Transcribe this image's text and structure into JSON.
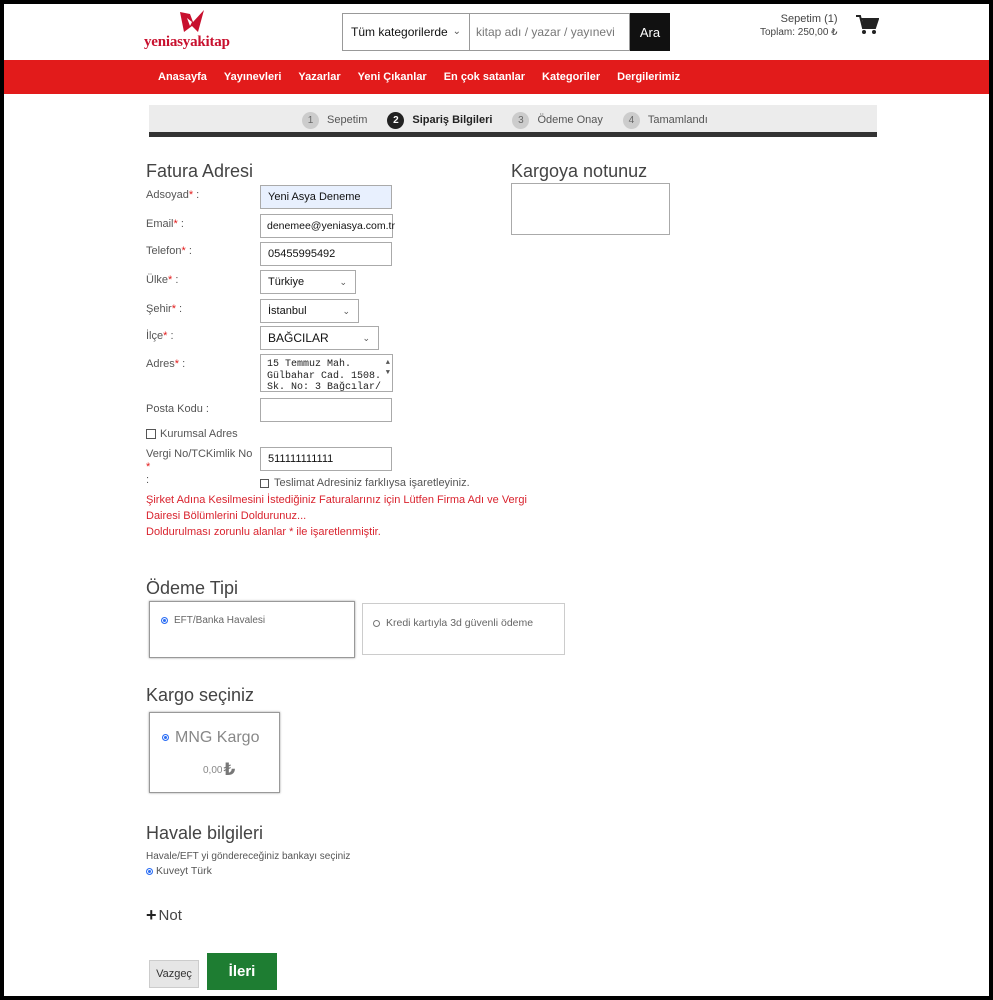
{
  "header": {
    "logo_text": "yeniasyakitap",
    "category_select": "Tüm kategorilerde",
    "search_placeholder": "kitap adı / yazar / yayınevi",
    "search_button": "Ara",
    "cart_label": "Sepetim (1)",
    "cart_total": "Toplam: 250,00 ₺"
  },
  "nav": {
    "items": [
      "Anasayfa",
      "Yayınevleri",
      "Yazarlar",
      "Yeni Çıkanlar",
      "En çok satanlar",
      "Kategoriler",
      "Dergilerimiz"
    ]
  },
  "steps": [
    {
      "num": "1",
      "label": "Sepetim"
    },
    {
      "num": "2",
      "label": "Sipariş Bilgileri"
    },
    {
      "num": "3",
      "label": "Ödeme Onay"
    },
    {
      "num": "4",
      "label": "Tamamlandı"
    }
  ],
  "invoice": {
    "title": "Fatura Adresi",
    "required_mark": "*",
    "fullname_label": "Adsoyad",
    "fullname_value": "Yeni Asya Deneme",
    "email_label": "Email",
    "email_value": "denemee@yeniasya.com.tr",
    "phone_label": "Telefon",
    "phone_value": "05455995492",
    "country_label": "Ülke",
    "country_value": "Türkiye",
    "city_label": "Şehir",
    "city_value": "İstanbul",
    "district_label": "İlçe",
    "district_value": "BAĞCILAR",
    "address_label": "Adres",
    "address_line1": "15 Temmuz Mah.",
    "address_line2": "Gülbahar Cad. 1508.",
    "address_line3": "Sk. No: 3 Bağcılar/",
    "postal_label": "Posta Kodu :",
    "postal_value": "",
    "corporate_label": "Kurumsal Adres",
    "taxid_label": "Vergi No/TCKimlik No",
    "taxid_value": "511111111111",
    "shipping_diff_label": "Teslimat Adresiniz farklıysa işaretleyiniz.",
    "note_line1": "Şirket Adına Kesilmesini İstediğiniz Faturalarınız için Lütfen Firma Adı ve Vergi",
    "note_line2": "Dairesi Bölümlerini Doldurunuz...",
    "note_line3": "Doldurulması zorunlu alanlar * ile işaretlenmiştir."
  },
  "cargo_note": {
    "title": "Kargoya notunuz",
    "value": ""
  },
  "payment": {
    "title": "Ödeme Tipi",
    "option1": "EFT/Banka Havalesi",
    "option2": "Kredi kartıyla 3d güvenli ödeme"
  },
  "cargo": {
    "title": "Kargo seçiniz",
    "option_name": "MNG Kargo",
    "option_price": "0,00",
    "currency": "₺"
  },
  "transfer": {
    "title": "Havale bilgileri",
    "instruction": "Havale/EFT yi göndereceğiniz bankayı seçiniz",
    "bank": "Kuveyt Türk"
  },
  "note_toggle": {
    "plus": "+",
    "label": "Not"
  },
  "actions": {
    "cancel": "Vazgeç",
    "next": "İleri"
  },
  "colors": {
    "brand_red": "#e21b1b",
    "next_green": "#1e7d32",
    "autofill_blue": "#e8f0fe"
  }
}
